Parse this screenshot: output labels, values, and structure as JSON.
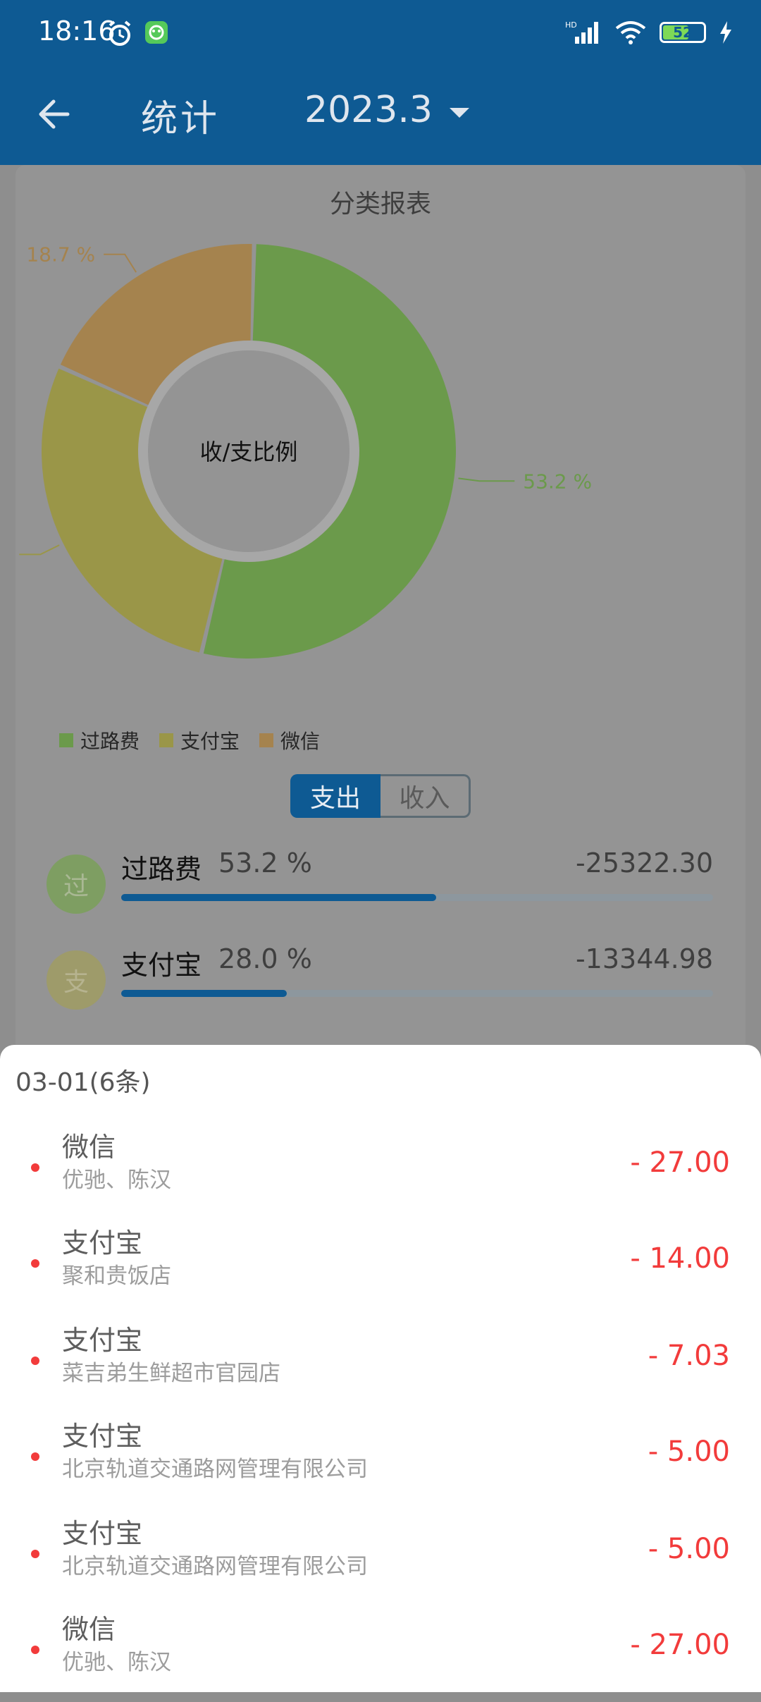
{
  "status_bar": {
    "time": "18:16",
    "battery": "52",
    "network": "HD"
  },
  "app_bar": {
    "title": "统计",
    "month": "2023.3"
  },
  "report": {
    "title": "分类报表",
    "center_label": "收/支比例"
  },
  "chart_data": {
    "type": "pie",
    "center_label": "收/支比例",
    "slices": [
      {
        "label": "过路费",
        "value": 53.2,
        "display": "53.2 %",
        "color": "#6b9a4b"
      },
      {
        "label": "支付宝",
        "value": 28.0,
        "display": "28.0 %",
        "color": "#9a9648"
      },
      {
        "label": "微信",
        "value": 18.7,
        "display": "18.7 %",
        "color": "#a5834e"
      }
    ],
    "legend_placement": "bottom-left"
  },
  "toggle": {
    "expense": "支出",
    "income": "收入"
  },
  "categories": [
    {
      "icon_char": "过",
      "name": "过路费",
      "percent": "53.2 %",
      "amount": "-25322.30",
      "ratio": 0.532,
      "icon_color": "#7e9e62"
    },
    {
      "icon_char": "支",
      "name": "支付宝",
      "percent": "28.0 %",
      "amount": "-13344.98",
      "ratio": 0.28,
      "icon_color": "#9e9b6a"
    }
  ],
  "sheet": {
    "title": "03-01(6条)",
    "transactions": [
      {
        "type": "微信",
        "merchant": "优驰、陈汉",
        "amount": "- 27.00"
      },
      {
        "type": "支付宝",
        "merchant": "聚和贵饭店",
        "amount": "- 14.00"
      },
      {
        "type": "支付宝",
        "merchant": "菜吉弟生鲜超市官园店",
        "amount": "- 7.03"
      },
      {
        "type": "支付宝",
        "merchant": "北京轨道交通路网管理有限公司",
        "amount": "- 5.00"
      },
      {
        "type": "支付宝",
        "merchant": "北京轨道交通路网管理有限公司",
        "amount": "- 5.00"
      },
      {
        "type": "微信",
        "merchant": "优驰、陈汉",
        "amount": "- 27.00"
      }
    ]
  },
  "colors": {
    "primary": "#0e5a93",
    "negative": "#f23b3b"
  }
}
